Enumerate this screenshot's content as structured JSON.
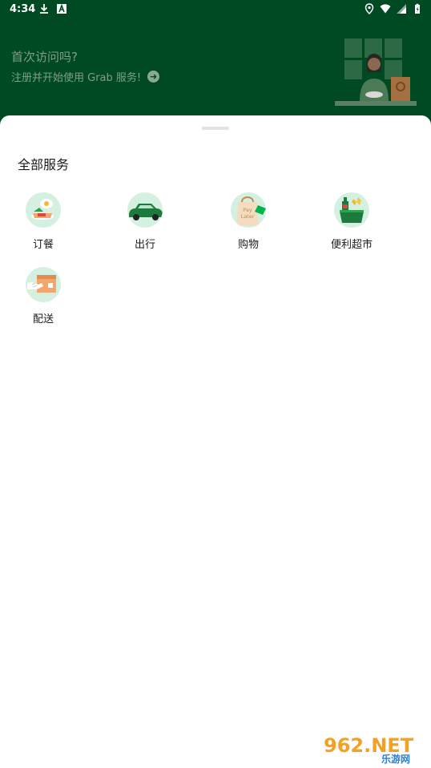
{
  "status_bar": {
    "time": "4:34",
    "left_icons": [
      "download-icon",
      "text-icon"
    ],
    "right_icons": [
      "location-icon",
      "wifi-icon",
      "signal-icon",
      "battery-icon"
    ]
  },
  "banner": {
    "title": "首次访问吗?",
    "subtitle": "注册并开始使用 Grab 服务!",
    "background_color": "#004a23"
  },
  "sheet": {
    "section_title": "全部服务",
    "services": [
      {
        "label": "订餐",
        "icon": "food-icon"
      },
      {
        "label": "出行",
        "icon": "car-icon"
      },
      {
        "label": "购物",
        "icon": "pay-later-bag-icon",
        "icon_text": [
          "Pay",
          "Later"
        ]
      },
      {
        "label": "便利超市",
        "icon": "grocery-icon"
      },
      {
        "label": "配送",
        "icon": "delivery-icon"
      }
    ]
  },
  "watermark": {
    "text": "962.NET",
    "subtext": "乐游网"
  }
}
